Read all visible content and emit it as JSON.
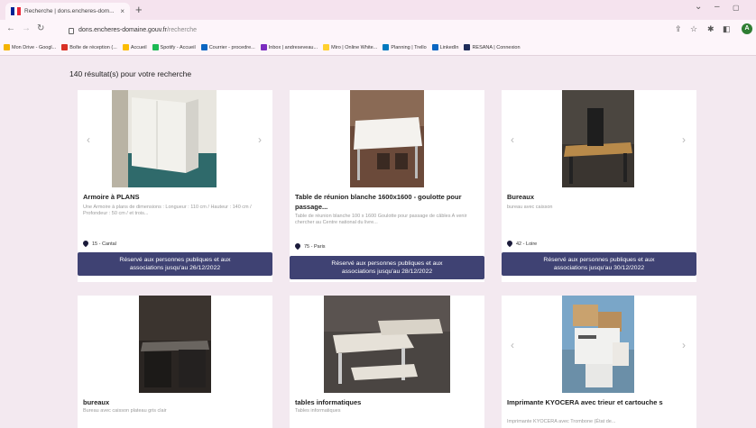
{
  "browser": {
    "tab_title": "Recherche | dons.encheres-dom... ×",
    "tab_title_text": "Recherche | dons.encheres-dom...",
    "new_tab": "+",
    "url_host": "dons.encheres-domaine.gouv.fr",
    "url_path": "/recherche",
    "bookmarks": [
      {
        "label": "Mon Drive - Googl...",
        "color": "#f4b400"
      },
      {
        "label": "Boîte de réception (...",
        "color": "#d93025"
      },
      {
        "label": "Accueil",
        "color": "#fbbc04"
      },
      {
        "label": "Spotify - Accueil",
        "color": "#1db954"
      },
      {
        "label": "Courrier - procedre...",
        "color": "#0a66c2"
      },
      {
        "label": "Inbox | andreseveau...",
        "color": "#7b2cbf"
      },
      {
        "label": "Miro | Online White...",
        "color": "#ffd02f"
      },
      {
        "label": "Planning | Trello",
        "color": "#0079bf"
      },
      {
        "label": "LinkedIn",
        "color": "#0a66c2"
      },
      {
        "label": "RESANA | Connexion",
        "color": "#1f2d5a"
      }
    ]
  },
  "results": {
    "count_label": "140 résultat(s) pour votre recherche"
  },
  "cards": [
    {
      "title": "Armoire à PLANS",
      "desc": "Une Armoire à plans de dimensions : Longueur : 110 cm / Hauteur : 140 cm / Profondeur : 50 cm / et trois...",
      "location": "15 - Cantal",
      "reserve": "Réservé aux personnes publiques et aux associations jusqu'au 26/12/2022"
    },
    {
      "title": "Table de réunion blanche 1600x1600 - goulotte pour passage...",
      "desc": "Table de réunion blanche 100 x 1600 Goulotte pour passage de câbles A venir chercher au Centre national du livre...",
      "location": "75 - Paris",
      "reserve": "Réservé aux personnes publiques et aux associations jusqu'au 28/12/2022"
    },
    {
      "title": "Bureaux",
      "desc": "bureau avec caisson",
      "location": "42 - Loire",
      "reserve": "Réservé aux personnes publiques et aux associations jusqu'au 30/12/2022"
    },
    {
      "title": "bureaux",
      "desc": "Bureau avec caisson plateau gris clair",
      "location": "",
      "reserve": ""
    },
    {
      "title": "tables informatiques",
      "desc": "Tables informatiques",
      "location": "",
      "reserve": ""
    },
    {
      "title": "Imprimante KYOCERA avec trieur et cartouche s",
      "desc": "Imprimante KYOCERA avec Trombone (État de...",
      "location": "",
      "reserve": ""
    }
  ],
  "colors": {
    "button": "#3f4273",
    "page_bg": "#f3e9f0",
    "card_bg": "#ffffff",
    "tab_bg": "#f5e3ee"
  }
}
